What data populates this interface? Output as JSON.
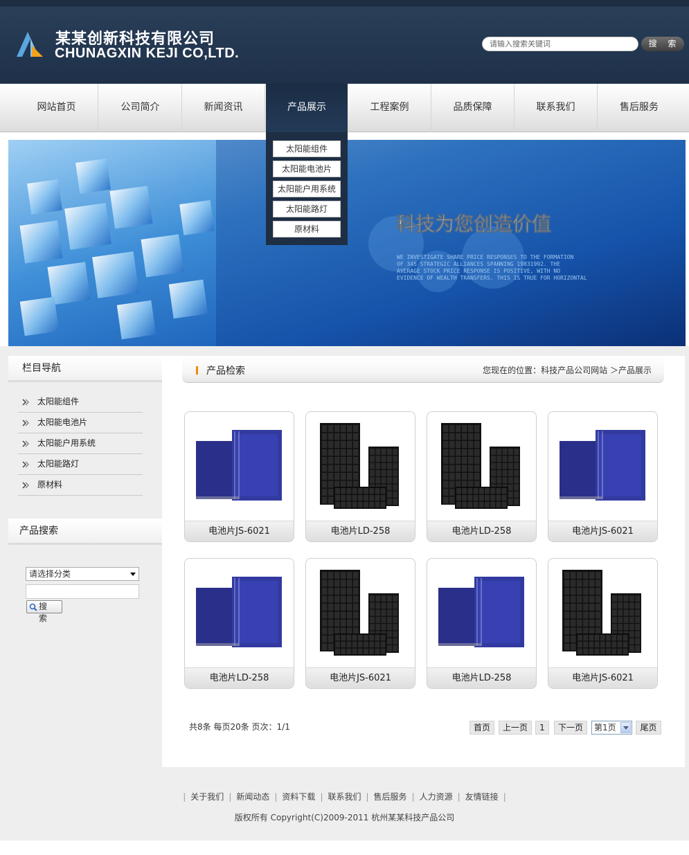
{
  "header": {
    "company_cn": "某某创新科技有限公司",
    "company_en": "CHUNAGXIN KEJI CO,LTD.",
    "search_placeholder": "请输入搜索关键词",
    "search_button": "搜 索"
  },
  "nav": {
    "items": [
      "网站首页",
      "公司简介",
      "新闻资讯",
      "产品展示",
      "工程案例",
      "品质保障",
      "联系我们",
      "售后服务"
    ],
    "active": "产品展示",
    "dropdown": [
      "太阳能组件",
      "太阳能电池片",
      "太阳能户用系统",
      "太阳能路灯",
      "原材料"
    ]
  },
  "banner": {
    "slogan": "科技为您创造价值",
    "body_lines": [
      "WE INVESTIGATE SHARE PRICE RESPONSES TO THE FORMATION",
      "OF 345 STRATEGIC ALLIANCES SPANNING 19831992. THE",
      "AVERAGE STOCK PRICE RESPONSE IS POSITIVE, WITH NO",
      "EVIDENCE OF WEALTH TRANSFERS. THIS IS TRUE FOR HORIZONTAL"
    ]
  },
  "sidebar": {
    "nav_title": "栏目导航",
    "links": [
      "太阳能组件",
      "太阳能电池片",
      "太阳能户用系统",
      "太阳能路灯",
      "原材料"
    ],
    "search_title": "产品搜索",
    "category_select": "请选择分类",
    "search_button": "搜 索"
  },
  "content": {
    "title": "产品检索",
    "breadcrumb": "您现在的位置：科技产品公司网站 ＞产品展示",
    "products": [
      {
        "name": "电池片JS-6021",
        "image": "cell"
      },
      {
        "name": "电池片LD-258",
        "image": "panel"
      },
      {
        "name": "电池片LD-258",
        "image": "panel"
      },
      {
        "name": "电池片JS-6021",
        "image": "cell"
      },
      {
        "name": "电池片LD-258",
        "image": "cell"
      },
      {
        "name": "电池片JS-6021",
        "image": "panel"
      },
      {
        "name": "电池片LD-258",
        "image": "cell"
      },
      {
        "name": "电池片JS-6021",
        "image": "panel"
      }
    ]
  },
  "pager": {
    "info": "共8条  每页20条  页次：1/1",
    "first": "首页",
    "prev": "上一页",
    "current": "1",
    "next": "下一页",
    "page_select": "第1页",
    "last": "尾页"
  },
  "footer": {
    "links": [
      "关于我们",
      "新闻动态",
      "资料下载",
      "联系我们",
      "售后服务",
      "人力资源",
      "友情链接"
    ],
    "copyright": "版权所有  Copyright(C)2009-2011 杭州某某科技产品公司"
  }
}
